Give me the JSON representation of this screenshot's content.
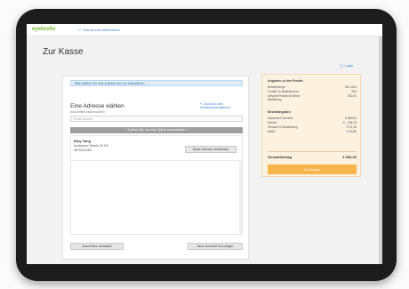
{
  "header": {
    "logo": "eyebrello",
    "back_link": "Zurück zum Warenkorb"
  },
  "page": {
    "title": "Zur Kasse",
    "login_link": "Login"
  },
  "address": {
    "info_message": "Bitte wählen Sie eine Adresse aus um fortzufahren",
    "section_title": "Eine Adresse wählen",
    "section_subtitle": "Anschriften durchsuchen",
    "edit_link": "Zurück zu den Versandinformationen",
    "search_placeholder": "Finde suchen",
    "select_bar_label": "* Suchen Sie, um eine Option auszuwählen *",
    "entries": [
      {
        "name": "Emy Yang",
        "street": "Ansbacher Straße 33 DE",
        "phone": "9876221245",
        "button_label": "Diese Adresse verwenden"
      }
    ],
    "manage_button": "Anschriften verwalten",
    "add_button": "Neue Anschrift hinzufügen"
  },
  "summary": {
    "points_heading": "Angaben zu den Punkte",
    "points_rows": [
      {
        "label": "Bestellmenge",
        "value": "Stk 1234"
      },
      {
        "label": "Punkte im Bestellmonat",
        "value": "500"
      },
      {
        "label": "Gesamt Punkte für diese Bestellung",
        "value": "932,00"
      }
    ],
    "order_heading": "Bestellangaben",
    "order_rows": [
      {
        "label": "Warenwert Gesamt",
        "value": "€ 889,93"
      },
      {
        "label": "Rabatt",
        "value": "€ - 238,75"
      },
      {
        "label": "Versand & Bearbeitung",
        "value": "€ 21,46"
      },
      {
        "label": "MwSt.",
        "value": "€ 40,56"
      }
    ],
    "total_label": "Gesamtbetrag",
    "total_value": "€ 656,20",
    "checkout_button": "Zur Kasse"
  }
}
